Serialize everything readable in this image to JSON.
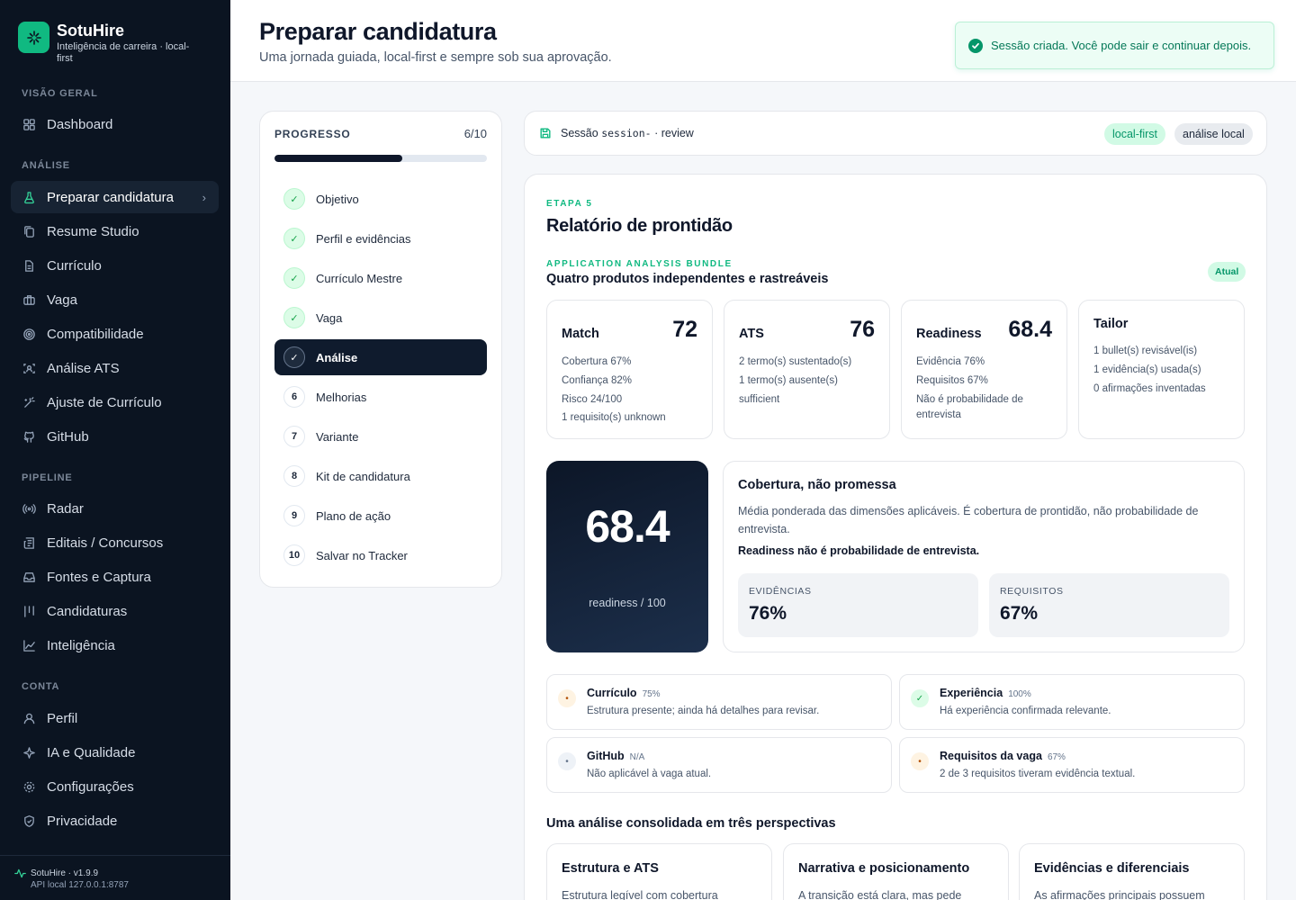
{
  "brand": {
    "name": "SotuHire",
    "tagline": "Inteligência de carreira · local-first"
  },
  "sidebar": {
    "sections": [
      {
        "label": "VISÃO GERAL"
      },
      {
        "label": "ANÁLISE"
      },
      {
        "label": "PIPELINE"
      },
      {
        "label": "CONTA"
      }
    ],
    "items": [
      {
        "label": "Dashboard",
        "icon": "grid-icon"
      },
      {
        "label": "Preparar candidatura",
        "icon": "flask-icon",
        "active": true
      },
      {
        "label": "Resume Studio",
        "icon": "copy-icon"
      },
      {
        "label": "Currículo",
        "icon": "file-icon"
      },
      {
        "label": "Vaga",
        "icon": "briefcase-icon"
      },
      {
        "label": "Compatibilidade",
        "icon": "target-icon"
      },
      {
        "label": "Análise ATS",
        "icon": "scan-icon"
      },
      {
        "label": "Ajuste de Currículo",
        "icon": "wand-icon"
      },
      {
        "label": "GitHub",
        "icon": "github-icon"
      },
      {
        "label": "Radar",
        "icon": "radar-icon"
      },
      {
        "label": "Editais / Concursos",
        "icon": "newspaper-icon"
      },
      {
        "label": "Fontes e Captura",
        "icon": "inbox-icon"
      },
      {
        "label": "Candidaturas",
        "icon": "columns-icon"
      },
      {
        "label": "Inteligência",
        "icon": "chart-icon"
      },
      {
        "label": "Perfil",
        "icon": "user-icon"
      },
      {
        "label": "IA e Qualidade",
        "icon": "sparkle-icon"
      },
      {
        "label": "Configurações",
        "icon": "gear-icon"
      },
      {
        "label": "Privacidade",
        "icon": "shield-icon"
      }
    ],
    "footer": {
      "version": "SotuHire · v1.9.9",
      "api": "API local 127.0.0.1:8787"
    }
  },
  "header": {
    "title": "Preparar candidatura",
    "subtitle": "Uma jornada guiada, local-first e sempre sob sua aprovação."
  },
  "toast": {
    "message": "Sessão criada. Você pode sair e continuar depois."
  },
  "progress": {
    "label": "PROGRESSO",
    "count": "6/10",
    "fraction": 0.6,
    "steps": [
      {
        "label": "Objetivo",
        "marker": "✓",
        "state": "done"
      },
      {
        "label": "Perfil e evidências",
        "marker": "✓",
        "state": "done"
      },
      {
        "label": "Currículo Mestre",
        "marker": "✓",
        "state": "done"
      },
      {
        "label": "Vaga",
        "marker": "✓",
        "state": "done"
      },
      {
        "label": "Análise",
        "marker": "✓",
        "state": "current"
      },
      {
        "label": "Melhorias",
        "marker": "6",
        "state": "todo"
      },
      {
        "label": "Variante",
        "marker": "7",
        "state": "todo"
      },
      {
        "label": "Kit de candidatura",
        "marker": "8",
        "state": "todo"
      },
      {
        "label": "Plano de ação",
        "marker": "9",
        "state": "todo"
      },
      {
        "label": "Salvar no Tracker",
        "marker": "10",
        "state": "todo"
      }
    ]
  },
  "session": {
    "prefix": "Sessão",
    "id": "session-",
    "suffix": "· review",
    "tag_local_first": "local-first",
    "tag_local_analysis": "análise local"
  },
  "stage": {
    "eyebrow": "ETAPA 5",
    "title": "Relatório de prontidão",
    "bundle_eyebrow": "APPLICATION ANALYSIS BUNDLE",
    "bundle_title": "Quatro produtos independentes e rastreáveis",
    "bundle_badge": "Atual"
  },
  "metrics": [
    {
      "name": "Match",
      "value": "72",
      "lines": [
        "Cobertura 67%",
        "Confiança 82%",
        "Risco 24/100",
        "1 requisito(s) unknown"
      ]
    },
    {
      "name": "ATS",
      "value": "76",
      "lines": [
        "2 termo(s) sustentado(s)",
        "1 termo(s) ausente(s)",
        "sufficient"
      ]
    },
    {
      "name": "Readiness",
      "value": "68.4",
      "lines": [
        "Evidência 76%",
        "Requisitos 67%",
        "Não é probabilidade de entrevista"
      ]
    },
    {
      "name": "Tailor",
      "value": "",
      "lines": [
        "1 bullet(s) revisável(is)",
        "1 evidência(s) usada(s)",
        "0 afirmações inventadas"
      ]
    }
  ],
  "score": {
    "value": "68.4",
    "caption": "readiness / 100"
  },
  "coverage": {
    "title": "Cobertura, não promessa",
    "description": "Média ponderada das dimensões aplicáveis. É cobertura de prontidão, não probabilidade de entrevista.",
    "warning": "Readiness não é probabilidade de entrevista.",
    "kpis": [
      {
        "label": "EVIDÊNCIAS",
        "value": "76%"
      },
      {
        "label": "REQUISITOS",
        "value": "67%"
      }
    ]
  },
  "dimensions": [
    {
      "title": "Currículo",
      "pct": "75%",
      "desc": "Estrutura presente; ainda há detalhes para revisar.",
      "status": "warn",
      "marker": "•"
    },
    {
      "title": "Experiência",
      "pct": "100%",
      "desc": "Há experiência confirmada relevante.",
      "status": "ok",
      "marker": "✓"
    },
    {
      "title": "GitHub",
      "pct": "N/A",
      "desc": "Não aplicável à vaga atual.",
      "status": "na",
      "marker": "•"
    },
    {
      "title": "Requisitos da vaga",
      "pct": "67%",
      "desc": "2 de 3 requisitos tiveram evidência textual.",
      "status": "warn",
      "marker": "•"
    }
  ],
  "perspectives": {
    "title": "Uma análise consolidada em três perspectivas",
    "items": [
      {
        "title": "Estrutura e ATS",
        "desc": "Estrutura legível com cobertura"
      },
      {
        "title": "Narrativa e posicionamento",
        "desc": "A transição está clara, mas pede"
      },
      {
        "title": "Evidências e diferenciais",
        "desc": "As afirmações principais possuem"
      }
    ]
  }
}
